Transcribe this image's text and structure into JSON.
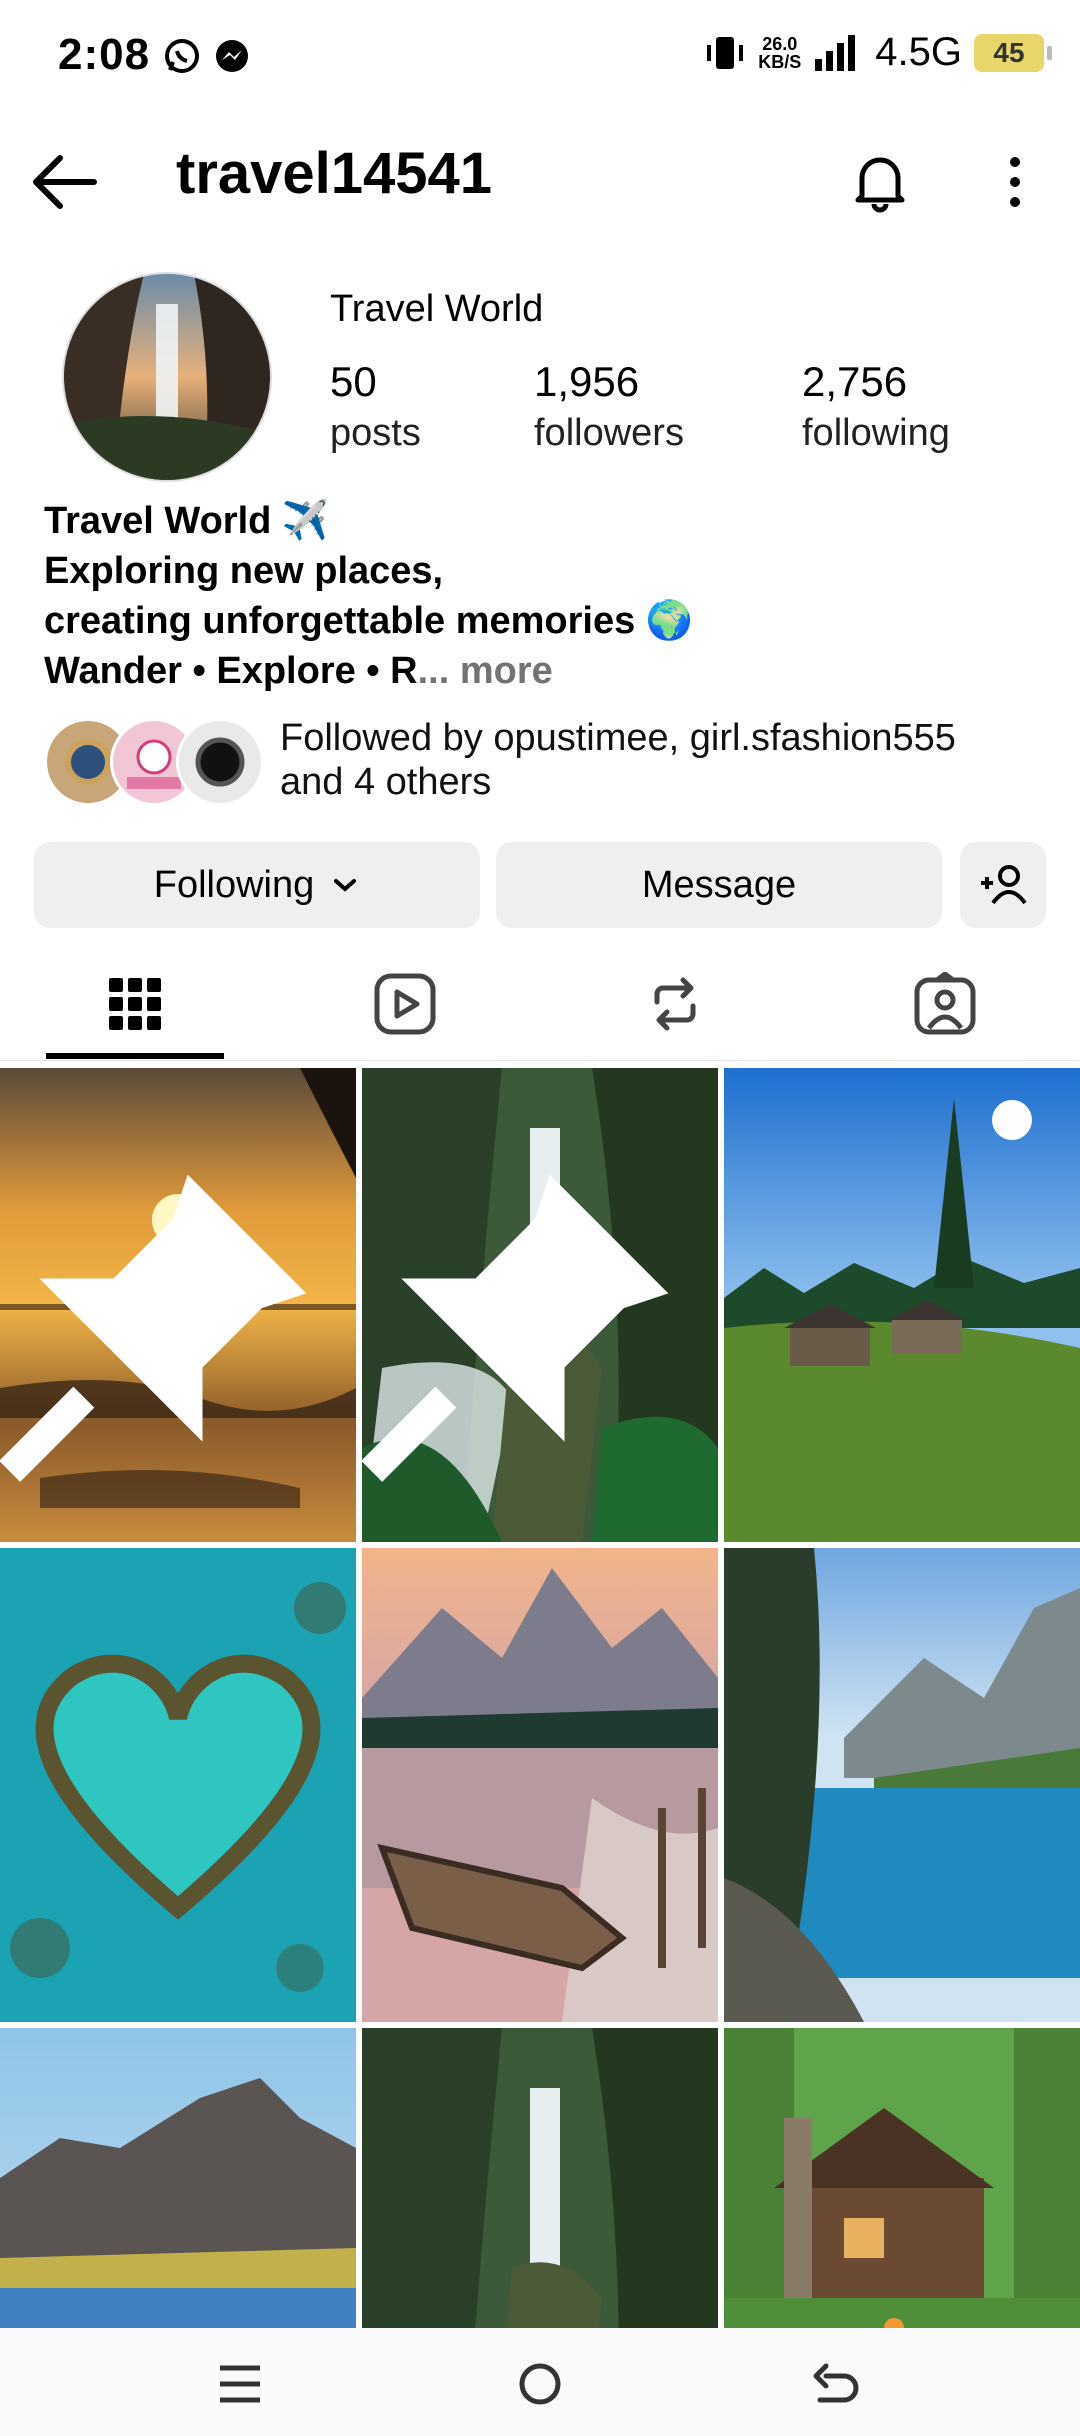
{
  "status": {
    "time": "2:08",
    "speed": "26.0",
    "speed_unit": "KB/S",
    "network": "4.5G",
    "battery": "45"
  },
  "header": {
    "username": "travel14541"
  },
  "profile": {
    "display_name": "Travel World",
    "posts": {
      "count": "50",
      "label": "posts"
    },
    "followers": {
      "count": "1,956",
      "label": "followers"
    },
    "following": {
      "count": "2,756",
      "label": "following"
    }
  },
  "bio": {
    "line1": "Travel World ✈️",
    "line2": "Exploring new places,",
    "line3": "creating unforgettable memories 🌍",
    "line4": "Wander • Explore • R",
    "ellipsis": "...",
    "more": " more"
  },
  "mutuals": {
    "line1": "Followed by opustimee, girl.sfashion555",
    "line2": "and 4 others"
  },
  "actions": {
    "following": "Following",
    "message": "Message"
  },
  "tabs": [
    "posts-grid-icon",
    "reels-icon",
    "reposts-icon",
    "tagged-icon"
  ],
  "grid": [
    {
      "name": "sunset-sea",
      "pinned": true
    },
    {
      "name": "jungle-waterfall",
      "pinned": true
    },
    {
      "name": "mountain-cabins",
      "pinned": false
    },
    {
      "name": "heart-reef",
      "pinned": false
    },
    {
      "name": "lake-boat",
      "pinned": false
    },
    {
      "name": "alpine-lake",
      "pinned": false
    },
    {
      "name": "black-mountain",
      "pinned": false
    },
    {
      "name": "jungle-waterfall-2",
      "pinned": false
    },
    {
      "name": "forest-cabin",
      "pinned": false
    }
  ],
  "colors": {
    "button_bg": "#efefef",
    "more_gray": "#737373",
    "battery": "#e9d66b"
  }
}
